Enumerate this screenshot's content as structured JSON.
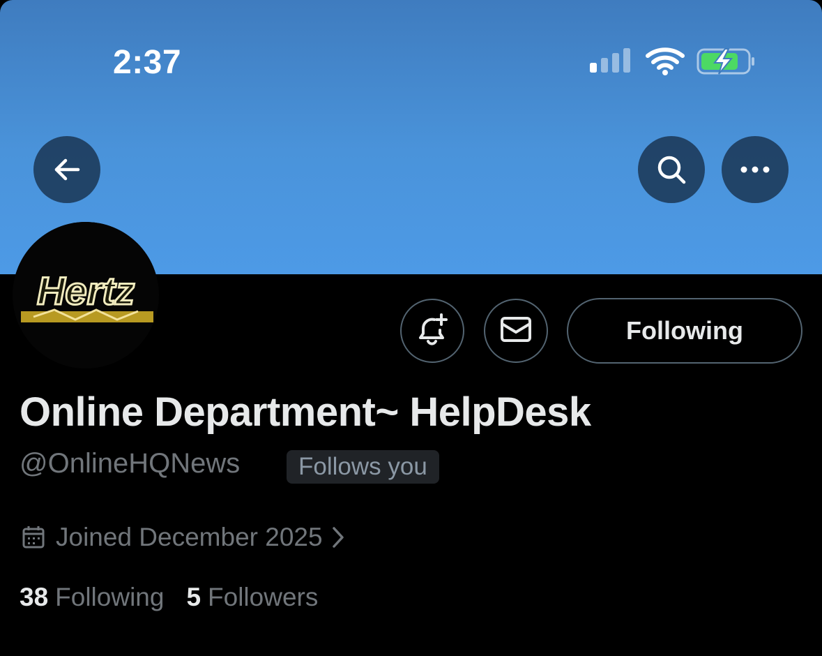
{
  "status_bar": {
    "time": "2:37",
    "signal_icon": "cellular-signal-icon",
    "wifi_icon": "wifi-icon",
    "battery_icon": "battery-charging-icon",
    "battery_color": "#4cd964"
  },
  "header": {
    "back_icon": "arrow-left-icon",
    "search_icon": "search-icon",
    "more_icon": "more-horizontal-icon",
    "banner_color": "#4a93da"
  },
  "profile": {
    "avatar_text": "Hertz",
    "display_name": "Online Department~ HelpDesk",
    "handle": "@OnlineHQNews",
    "follows_you": "Follows you",
    "joined": "Joined December 2025",
    "following_count": "38",
    "following_label": "Following",
    "followers_count": "5",
    "followers_label": "Followers"
  },
  "actions": {
    "notify_icon": "bell-plus-icon",
    "message_icon": "envelope-icon",
    "following_button": "Following"
  }
}
